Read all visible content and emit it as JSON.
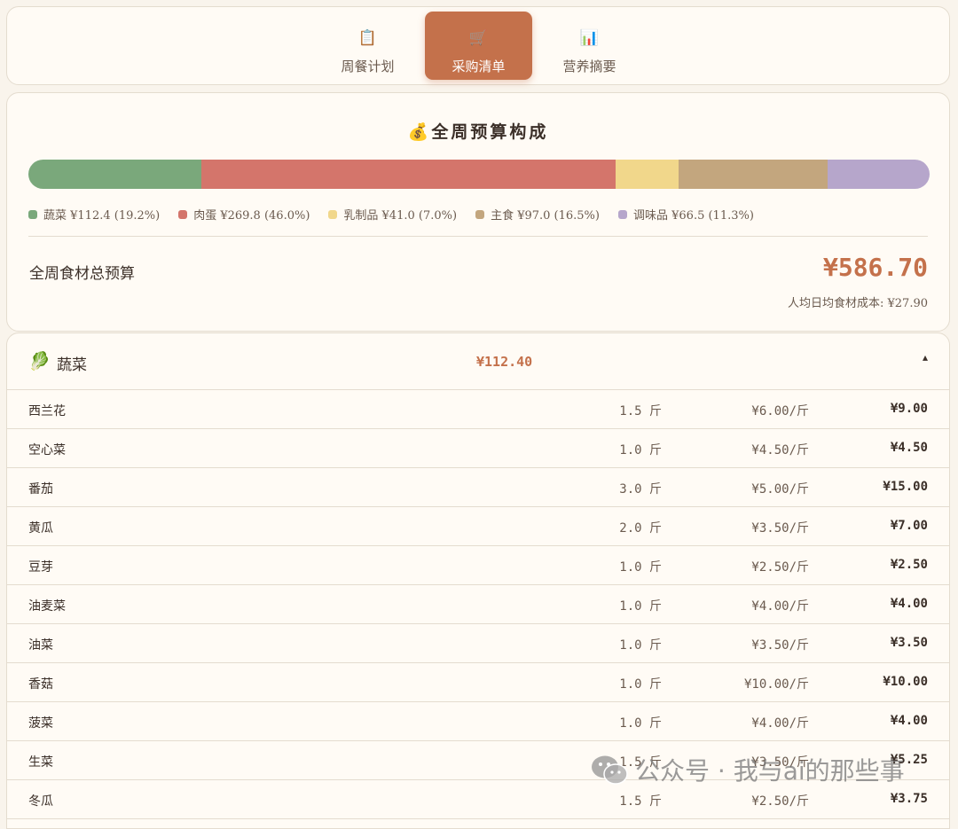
{
  "tabs": [
    {
      "icon": "📋",
      "label": "周餐计划",
      "active": false
    },
    {
      "icon": "🛒",
      "label": "采购清单",
      "active": true
    },
    {
      "icon": "📊",
      "label": "营养摘要",
      "active": false
    }
  ],
  "budget": {
    "title": "💰全周预算构成",
    "segments": [
      {
        "label": "蔬菜 ¥112.4 (19.2%)",
        "value": 112.4,
        "color": "#7aa87b"
      },
      {
        "label": "肉蛋 ¥269.8 (46.0%)",
        "value": 269.8,
        "color": "#d4756b"
      },
      {
        "label": "乳制品 ¥41.0 (7.0%)",
        "value": 41.0,
        "color": "#f1d78b"
      },
      {
        "label": "主食 ¥97.0 (16.5%)",
        "value": 97.0,
        "color": "#c3a67e"
      },
      {
        "label": "调味品 ¥66.5 (11.3%)",
        "value": 66.5,
        "color": "#b6a6cb"
      }
    ],
    "total_label": "全周食材总预算",
    "total_value": "¥586.70",
    "daily_cost": "人均日均食材成本: ¥27.90"
  },
  "category": {
    "icon": "🥬",
    "name": "蔬菜",
    "total": "¥112.40",
    "toggle": "▴",
    "items": [
      {
        "name": "西兰花",
        "qty": "1.5 斤",
        "price": "¥6.00/斤",
        "subtotal": "¥9.00"
      },
      {
        "name": "空心菜",
        "qty": "1.0 斤",
        "price": "¥4.50/斤",
        "subtotal": "¥4.50"
      },
      {
        "name": "番茄",
        "qty": "3.0 斤",
        "price": "¥5.00/斤",
        "subtotal": "¥15.00"
      },
      {
        "name": "黄瓜",
        "qty": "2.0 斤",
        "price": "¥3.50/斤",
        "subtotal": "¥7.00"
      },
      {
        "name": "豆芽",
        "qty": "1.0 斤",
        "price": "¥2.50/斤",
        "subtotal": "¥2.50"
      },
      {
        "name": "油麦菜",
        "qty": "1.0 斤",
        "price": "¥4.00/斤",
        "subtotal": "¥4.00"
      },
      {
        "name": "油菜",
        "qty": "1.0 斤",
        "price": "¥3.50/斤",
        "subtotal": "¥3.50"
      },
      {
        "name": "香菇",
        "qty": "1.0 斤",
        "price": "¥10.00/斤",
        "subtotal": "¥10.00"
      },
      {
        "name": "菠菜",
        "qty": "1.0 斤",
        "price": "¥4.00/斤",
        "subtotal": "¥4.00"
      },
      {
        "name": "生菜",
        "qty": "1.5 斤",
        "price": "¥3.50/斤",
        "subtotal": "¥5.25"
      },
      {
        "name": "冬瓜",
        "qty": "1.5 斤",
        "price": "¥2.50/斤",
        "subtotal": "¥3.75"
      }
    ]
  },
  "watermark": {
    "text": "公众号 · 我与ai的那些事"
  }
}
